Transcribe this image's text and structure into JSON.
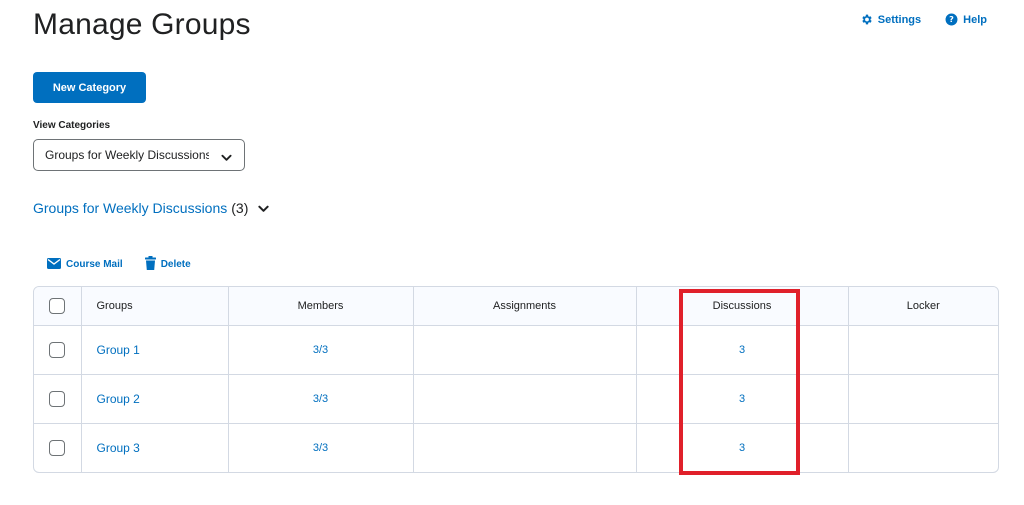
{
  "page": {
    "title": "Manage Groups"
  },
  "top_links": {
    "settings": "Settings",
    "help": "Help"
  },
  "toolbar": {
    "new_category_label": "New Category"
  },
  "view_categories": {
    "label": "View Categories",
    "selected": "Groups for Weekly Discussions"
  },
  "section": {
    "title": "Groups for Weekly Discussions",
    "count": "(3)"
  },
  "actions": {
    "course_mail": "Course Mail",
    "delete": "Delete"
  },
  "table": {
    "headers": {
      "groups": "Groups",
      "members": "Members",
      "assignments": "Assignments",
      "discussions": "Discussions",
      "locker": "Locker"
    },
    "rows": [
      {
        "group": "Group 1",
        "members": "3/3",
        "assignments": "",
        "discussions": "3",
        "locker": ""
      },
      {
        "group": "Group 2",
        "members": "3/3",
        "assignments": "",
        "discussions": "3",
        "locker": ""
      },
      {
        "group": "Group 3",
        "members": "3/3",
        "assignments": "",
        "discussions": "3",
        "locker": ""
      }
    ]
  },
  "icons": {
    "settings": "gear-icon",
    "help": "help-circle-icon",
    "mail": "envelope-icon",
    "delete": "trash-icon",
    "dropdown": "chevron-down-icon"
  },
  "colors": {
    "accent": "#006fbf",
    "highlight": "#e0202a",
    "text": "#202122"
  }
}
